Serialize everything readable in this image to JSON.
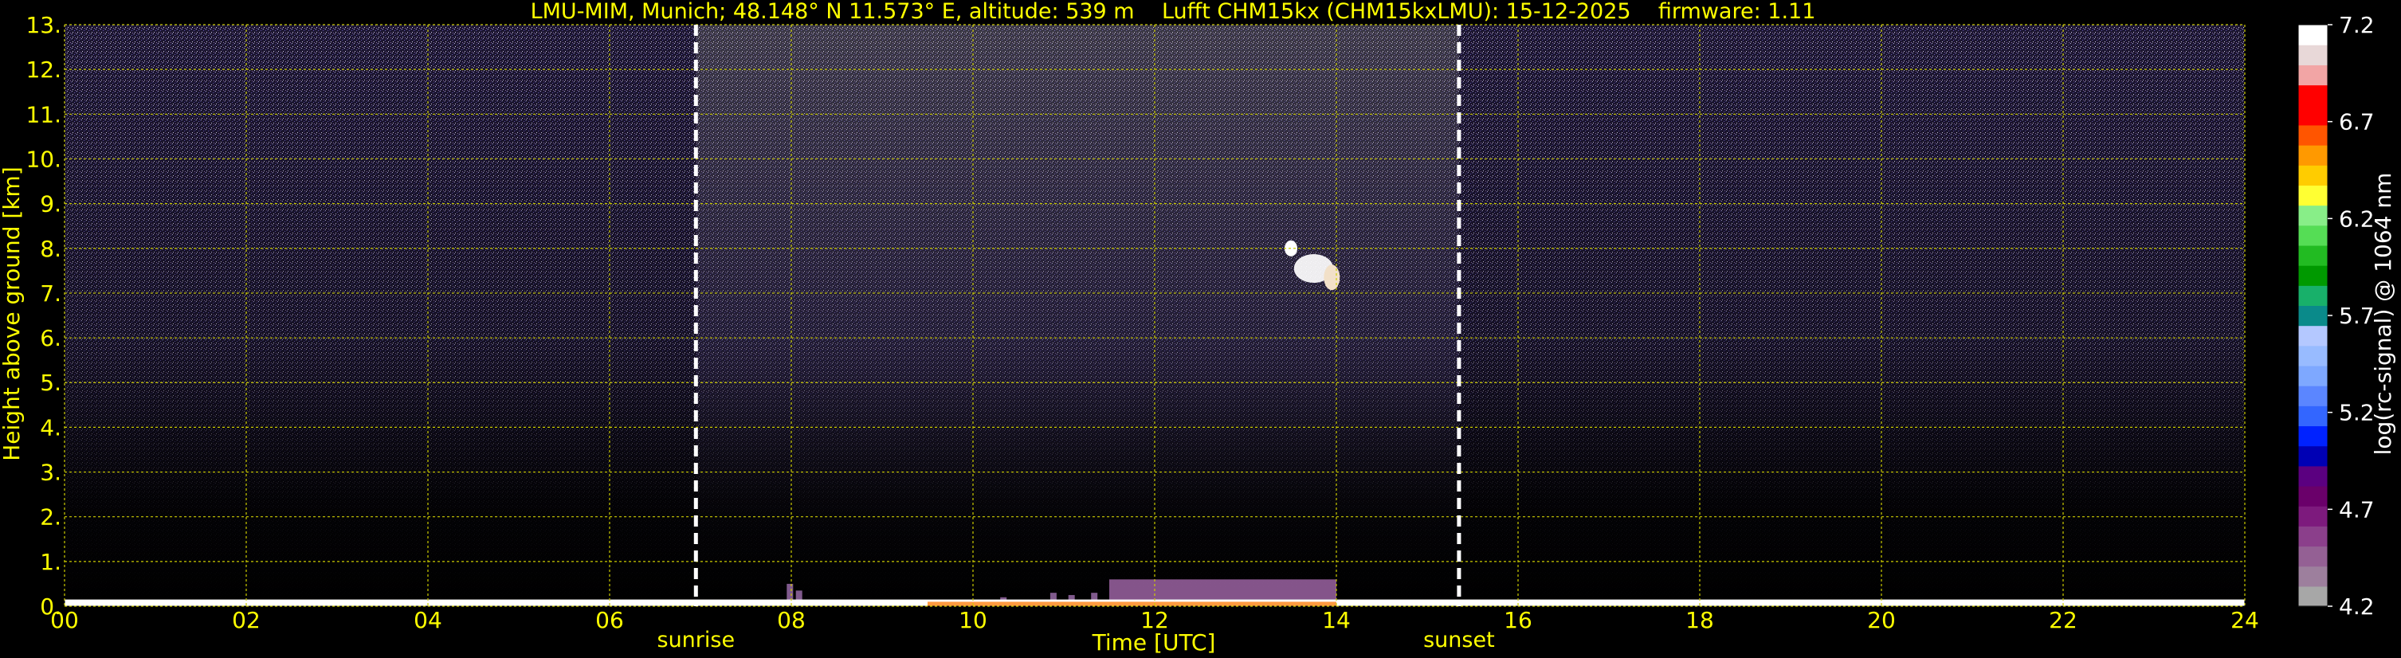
{
  "chart_data": {
    "type": "heatmap",
    "title": "LMU-MIM, Munich; 48.148° N 11.573° E, altitude: 539 m    Lufft CHM15kx (CHM15kxLMU): 15-12-2025    firmware: 1.11",
    "xlabel": "Time [UTC]",
    "ylabel": "Height above ground [km]",
    "xlim": [
      0,
      24
    ],
    "ylim": [
      0,
      13
    ],
    "x_ticks": [
      "00",
      "02",
      "04",
      "06",
      "08",
      "10",
      "12",
      "14",
      "16",
      "18",
      "20",
      "22",
      "24"
    ],
    "y_ticks": [
      "0.",
      "1.",
      "2.",
      "3.",
      "4.",
      "5.",
      "6.",
      "7.",
      "8.",
      "9.",
      "10.",
      "11.",
      "12.",
      "13."
    ],
    "grid": true,
    "events": [
      {
        "label": "sunrise",
        "time": 6.95
      },
      {
        "label": "sunset",
        "time": 15.35
      }
    ],
    "colorbar": {
      "label": "log(rc-signal) @ 1064 nm",
      "range": [
        4.2,
        7.2
      ],
      "ticks": [
        "4.2",
        "4.7",
        "5.2",
        "5.7",
        "6.2",
        "6.7",
        "7.2"
      ],
      "colors": [
        "#a7a7a7",
        "#9d7f9d",
        "#946094",
        "#8b3f8b",
        "#7d1a7d",
        "#6a006a",
        "#5b0080",
        "#0000b4",
        "#0022ff",
        "#3366ff",
        "#5b86ff",
        "#7ea8ff",
        "#98bbff",
        "#b4c8ff",
        "#0a8a8a",
        "#18b06a",
        "#009900",
        "#22bb22",
        "#55dd55",
        "#88ee88",
        "#ffff33",
        "#ffcc00",
        "#ff9900",
        "#ff5500",
        "#ff0000",
        "#ff0000",
        "#f2a5a5",
        "#e8d8d8",
        "#ffffff"
      ]
    },
    "features": {
      "boundary_layer_top_km": 0.15,
      "daytime_aerosol_layer": {
        "time_range": [
          11.5,
          14
        ],
        "top_km": 0.6
      },
      "cirrus_patch": {
        "time_range": [
          13.4,
          14.05
        ],
        "height_range": [
          7.1,
          8.2
        ]
      }
    }
  },
  "colors": {
    "text": "#ffff00",
    "colorbar_text": "#ffffff",
    "background": "#000000",
    "grid": "#cccc00"
  }
}
